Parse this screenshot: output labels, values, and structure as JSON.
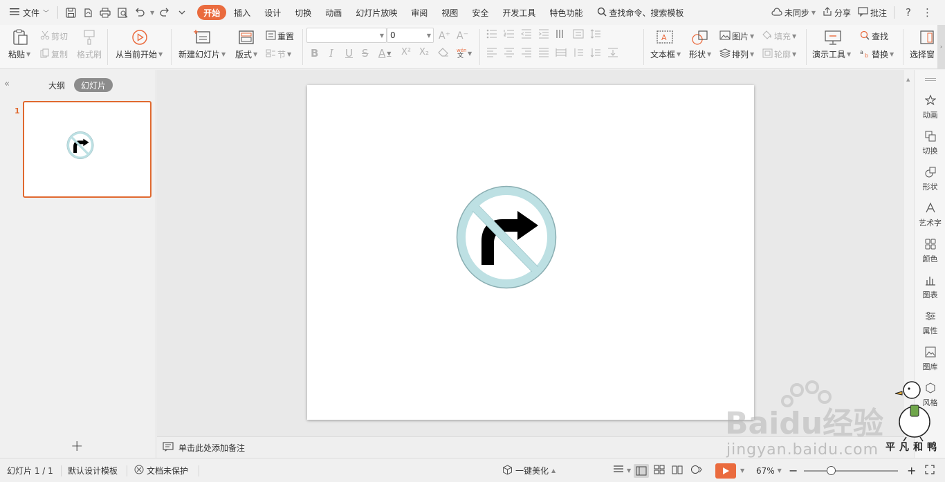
{
  "menubar": {
    "file_label": "文件",
    "tabs": [
      {
        "label": "开始",
        "active": true
      },
      {
        "label": "插入"
      },
      {
        "label": "设计"
      },
      {
        "label": "切换"
      },
      {
        "label": "动画"
      },
      {
        "label": "幻灯片放映"
      },
      {
        "label": "审阅"
      },
      {
        "label": "视图"
      },
      {
        "label": "安全"
      },
      {
        "label": "开发工具"
      },
      {
        "label": "特色功能"
      }
    ],
    "search_label": "查找命令、搜索模板",
    "sync_label": "未同步",
    "share_label": "分享",
    "comment_label": "批注",
    "help_label": "?",
    "more_label": "⋮"
  },
  "ribbon": {
    "paste": "粘贴",
    "cut": "剪切",
    "copy": "复制",
    "format_painter": "格式刷",
    "from_current": "从当前开始",
    "new_slide": "新建幻灯片",
    "layout": "版式",
    "reset": "重置",
    "section": "节",
    "font_name": "",
    "font_size": "0",
    "grow_font": "A⁺",
    "shrink_font": "A⁻",
    "bold": "B",
    "italic": "I",
    "underline": "U",
    "strike": "S",
    "font_color": "A",
    "superscript": "X²",
    "subscript": "X₂",
    "textbox": "文本框",
    "shape": "形状",
    "picture": "图片",
    "fill": "填充",
    "arrange": "排列",
    "outline": "轮廓",
    "present_tools": "演示工具",
    "find": "查找",
    "replace": "替换",
    "select_pane": "选择窗"
  },
  "left_panel": {
    "outline_tab": "大纲",
    "slides_tab": "幻灯片",
    "slide_number": "1",
    "add_slide": "+"
  },
  "notes": {
    "placeholder": "单击此处添加备注"
  },
  "right_sidebar": {
    "items": [
      "动画",
      "切换",
      "形状",
      "艺术字",
      "颜色",
      "图表",
      "属性",
      "图库",
      "风格"
    ]
  },
  "statusbar": {
    "slide_info": "幻灯片 1 / 1",
    "template": "默认设计模板",
    "protect": "文档未保护",
    "beautify": "一键美化",
    "zoom": "67%",
    "zoom_level": 0.29
  },
  "watermark": {
    "brand": "Baidu经验",
    "url": "jingyan.baidu.com",
    "tag": "平凡和鸭"
  },
  "colors": {
    "accent": "#ea6b3e",
    "sign_ring": "#bde0e3",
    "sign_stroke": "#8aaeb2",
    "arrow": "#000000"
  },
  "icons": {
    "sign": "no-right-turn-sign"
  }
}
